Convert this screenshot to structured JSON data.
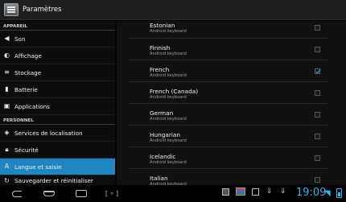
{
  "actionbar": {
    "title": "Paramètres",
    "icon": "settings-icon"
  },
  "sidebar": {
    "sections": [
      {
        "header": "APPAREIL",
        "items": [
          {
            "label": "Son",
            "icon": "speaker-icon",
            "glyph": "◀"
          },
          {
            "label": "Affichage",
            "icon": "brightness-icon",
            "glyph": "◐"
          },
          {
            "label": "Stockage",
            "icon": "storage-icon",
            "glyph": "≡"
          },
          {
            "label": "Batterie",
            "icon": "battery-icon",
            "glyph": "▮"
          },
          {
            "label": "Applications",
            "icon": "apps-icon",
            "glyph": "▣"
          }
        ]
      },
      {
        "header": "PERSONNEL",
        "items": [
          {
            "label": "Services de localisation",
            "icon": "location-icon",
            "glyph": "◈"
          },
          {
            "label": "Sécurité",
            "icon": "lock-icon",
            "glyph": "🔒︎"
          },
          {
            "label": "Langue et saisie",
            "icon": "language-icon",
            "glyph": "A",
            "selected": true
          },
          {
            "label": "Sauvegarder et réinitialiser",
            "icon": "backup-icon",
            "glyph": "↻"
          }
        ]
      }
    ]
  },
  "keyboards": {
    "subtitle": "Android keyboard",
    "items": [
      {
        "name": "Estonian",
        "checked": false
      },
      {
        "name": "Finnish",
        "checked": false
      },
      {
        "name": "French",
        "checked": true
      },
      {
        "name": "French (Canada)",
        "checked": false
      },
      {
        "name": "German",
        "checked": false
      },
      {
        "name": "Hungarian",
        "checked": false
      },
      {
        "name": "Icelandic",
        "checked": false
      },
      {
        "name": "Italian",
        "checked": false
      }
    ]
  },
  "statusbar": {
    "time": "19:09",
    "accent": "#33b5e5",
    "selection": "#1d86c3"
  }
}
